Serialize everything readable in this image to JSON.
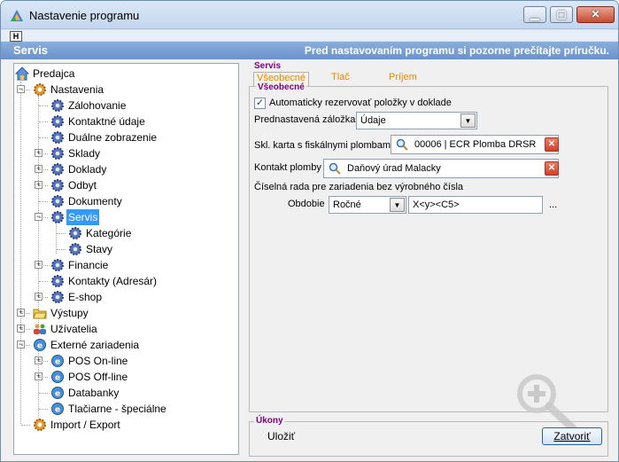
{
  "window": {
    "title": "Nastavenie programu",
    "help_badge": "H",
    "banner_left": "Servis",
    "banner_right": "Pred nastavovaním programu si pozorne prečítajte príručku."
  },
  "tree": {
    "items": [
      {
        "label": "Predajca",
        "icon": "home-icon"
      },
      {
        "label": "Nastavenia",
        "icon": "gear-orange-icon"
      },
      {
        "label": "Zálohovanie",
        "icon": "gear-blue-icon"
      },
      {
        "label": "Kontaktné údaje",
        "icon": "gear-blue-icon"
      },
      {
        "label": "Duálne zobrazenie",
        "icon": "gear-blue-icon"
      },
      {
        "label": "Sklady",
        "icon": "gear-blue-icon"
      },
      {
        "label": "Doklady",
        "icon": "gear-blue-icon"
      },
      {
        "label": "Odbyt",
        "icon": "gear-blue-icon"
      },
      {
        "label": "Dokumenty",
        "icon": "gear-blue-icon"
      },
      {
        "label": "Servis",
        "icon": "gear-blue-icon",
        "selected": true
      },
      {
        "label": "Kategórie",
        "icon": "gear-blue-icon"
      },
      {
        "label": "Stavy",
        "icon": "gear-blue-icon"
      },
      {
        "label": "Financie",
        "icon": "gear-blue-icon"
      },
      {
        "label": "Kontakty (Adresár)",
        "icon": "gear-blue-icon"
      },
      {
        "label": "E-shop",
        "icon": "gear-blue-icon"
      },
      {
        "label": "Výstupy",
        "icon": "folder-icon"
      },
      {
        "label": "Užívatelia",
        "icon": "users-icon"
      },
      {
        "label": "Externé zariadenia",
        "icon": "device-icon"
      },
      {
        "label": "POS On-line",
        "icon": "device-icon"
      },
      {
        "label": "POS Off-line",
        "icon": "device-icon"
      },
      {
        "label": "Databanky",
        "icon": "device-icon"
      },
      {
        "label": "Tlačiarne - špeciálne",
        "icon": "device-icon"
      },
      {
        "label": "Import / Export",
        "icon": "gear-orange-icon"
      }
    ]
  },
  "servis": {
    "group_title": "Servis",
    "tabs": [
      "Všeobecné",
      "Tlač",
      "Príjem"
    ],
    "section_title": "Všeobecné",
    "auto_reserve": {
      "label": "Automaticky rezervovať položky v doklade",
      "checked": true
    },
    "default_tab": {
      "label": "Prednastavená záložka",
      "value": "Údaje"
    },
    "fiscal_card": {
      "label": "Skl. karta s fiskálnymi plombami",
      "value": "00006 | ECR Plomba DRSR"
    },
    "seal_contact": {
      "label": "Kontakt plomby",
      "value": "Daňový úrad Malacky"
    },
    "series": {
      "label": "Číselná rada pre zariadenia bez výrobného čísla",
      "period_label": "Obdobie",
      "period_value": "Ročné",
      "mask": "X<y><C5>",
      "more": "..."
    }
  },
  "actions": {
    "group_title": "Úkony",
    "save": "Uložiť",
    "close": "Zatvoriť"
  },
  "colors": {
    "banner": "#7aa1d5",
    "accent_tab": "#e08a00",
    "group_title": "#800080",
    "selection": "#3399ff"
  }
}
